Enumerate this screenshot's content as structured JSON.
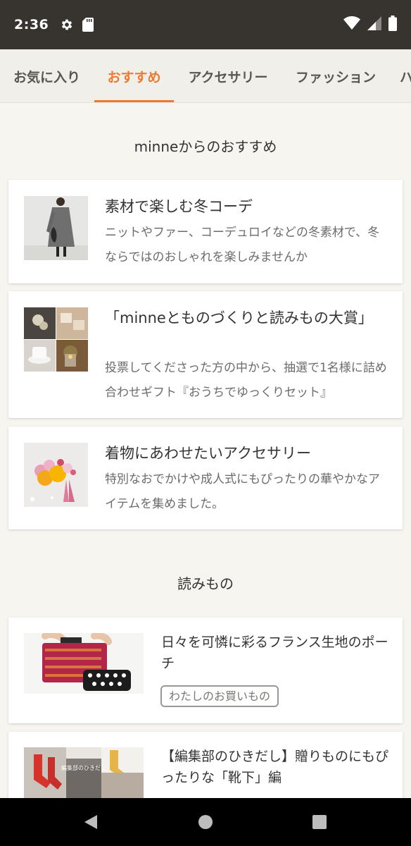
{
  "status_bar": {
    "time": "2:36",
    "icons": [
      "gear-icon",
      "sd-card-icon",
      "wifi-icon",
      "signal-icon",
      "battery-icon"
    ]
  },
  "tabs": [
    {
      "label": "お気に入り",
      "active": false
    },
    {
      "label": "おすすめ",
      "active": true
    },
    {
      "label": "アクセサリー",
      "active": false
    },
    {
      "label": "ファッション",
      "active": false
    },
    {
      "label": "ハ",
      "active": false
    }
  ],
  "colors": {
    "accent": "#ec7a35",
    "status_bar": "#37332f",
    "background": "#f7f5f0"
  },
  "recommend": {
    "heading": "minneからのおすすめ",
    "items": [
      {
        "title": "素材で楽しむ冬コーデ",
        "description": "ニットやファー、コーデュロイなどの冬素材で、冬ならではのおしゃれを楽しみませんか"
      },
      {
        "title": "「minneとものづくりと読みもの大賞」",
        "description": "投票してくださった方の中から、抽選で1名様に詰め合わせギフト『おうちでゆっくりセット』"
      },
      {
        "title": "着物にあわせたいアクセサリー",
        "description": "特別なおでかけや成人式にもぴったりの華やかなアイテムを集めました。"
      }
    ]
  },
  "reading": {
    "heading": "読みもの",
    "items": [
      {
        "title": "日々を可憐に彩るフランス生地のポーチ",
        "tag": "わたしのお買いもの"
      },
      {
        "title": "【編集部のひきだし】贈りものにもぴったりな「靴下」編",
        "overlay": "編集部のひきだし"
      }
    ]
  }
}
